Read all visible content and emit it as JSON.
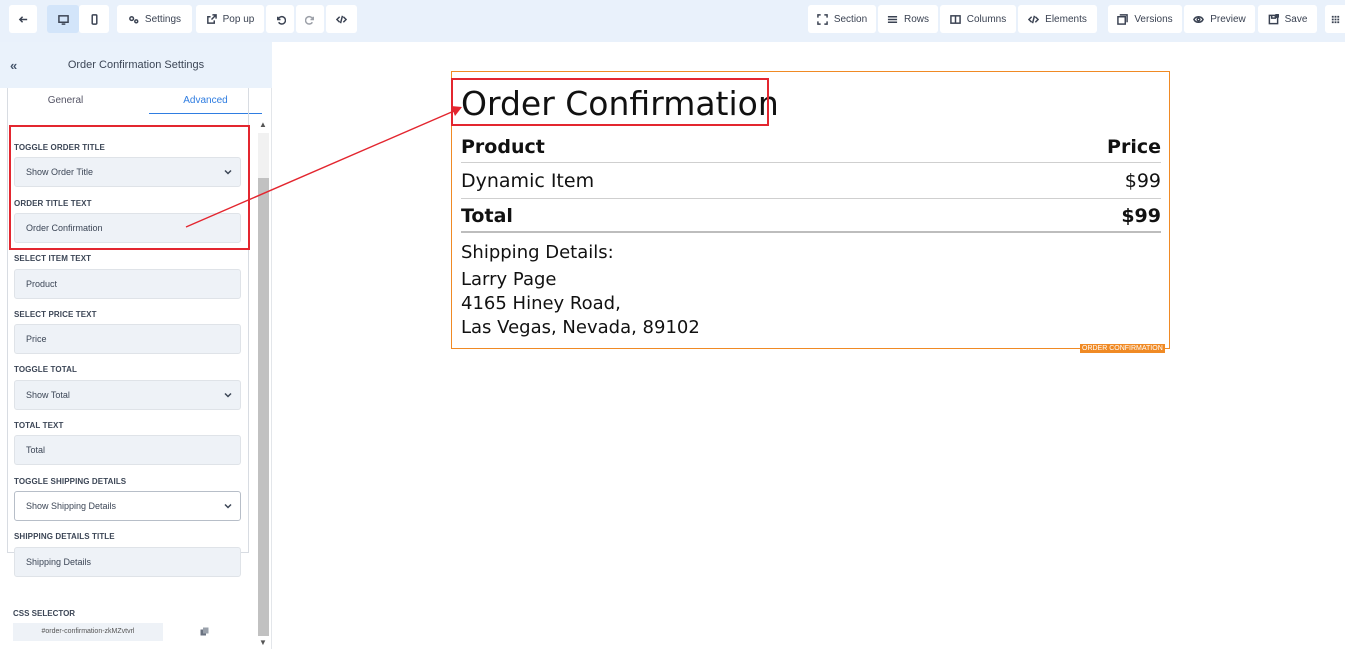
{
  "toolbar": {
    "settings_label": "Settings",
    "popup_label": "Pop up",
    "section_label": "Section",
    "rows_label": "Rows",
    "columns_label": "Columns",
    "elements_label": "Elements",
    "versions_label": "Versions",
    "preview_label": "Preview",
    "save_label": "Save"
  },
  "panel": {
    "title": "Order Confirmation Settings",
    "tabs": [
      {
        "label": "General",
        "active": false
      },
      {
        "label": "Advanced",
        "active": true
      }
    ],
    "fields": [
      {
        "label": "TOGGLE ORDER TITLE",
        "value": "Show Order Title",
        "type": "select"
      },
      {
        "label": "ORDER TITLE TEXT",
        "value": "Order Confirmation",
        "type": "text"
      },
      {
        "label": "SELECT ITEM TEXT",
        "value": "Product",
        "type": "text"
      },
      {
        "label": "SELECT PRICE TEXT",
        "value": "Price",
        "type": "text"
      },
      {
        "label": "TOGGLE TOTAL",
        "value": "Show Total",
        "type": "select"
      },
      {
        "label": "TOTAL TEXT",
        "value": "Total",
        "type": "text"
      },
      {
        "label": "TOGGLE SHIPPING DETAILS",
        "value": "Show Shipping Details",
        "type": "select"
      },
      {
        "label": "SHIPPING DETAILS TITLE",
        "value": "Shipping Details",
        "type": "text"
      }
    ],
    "css_selector_label": "CSS SELECTOR",
    "css_selector_value": "#order-confirmation-zkMZvtvrl"
  },
  "preview": {
    "order_title": "Order Confirmation",
    "product_header": "Product",
    "price_header": "Price",
    "item_name": "Dynamic Item",
    "item_price": "$99",
    "total_label": "Total",
    "total_value": "$99",
    "shipping_title": "Shipping Details:",
    "shipping_lines": [
      "Larry Page",
      "4165 Hiney Road,",
      "Las Vegas, Nevada, 89102"
    ],
    "widget_tag": "ORDER CONFIRMATION"
  },
  "colors": {
    "accent": "#2f7de1",
    "highlight": "#e3262f",
    "widget_border": "#f08a24"
  }
}
